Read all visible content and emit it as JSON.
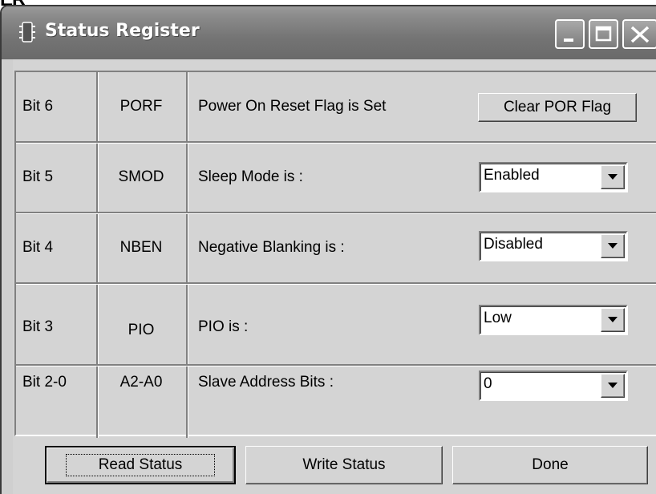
{
  "top_fragment": "ER",
  "window": {
    "title": "Status Register",
    "icon": "register-icon",
    "controls": [
      "minimize-icon",
      "maximize-icon",
      "close-icon"
    ]
  },
  "rows": [
    {
      "bit": "Bit 6",
      "name": "PORF",
      "desc": "Power On Reset Flag is Set",
      "control": "button",
      "button_label": "Clear POR Flag"
    },
    {
      "bit": "Bit 5",
      "name": "SMOD",
      "desc": "Sleep Mode is :",
      "control": "select",
      "value": "Enabled"
    },
    {
      "bit": "Bit 4",
      "name": "NBEN",
      "desc": "Negative Blanking is :",
      "control": "select",
      "value": "Disabled"
    },
    {
      "bit": "Bit 3",
      "name": "PIO",
      "desc": "PIO is :",
      "control": "select",
      "value": "Low"
    },
    {
      "bit": "Bit 2-0",
      "name": "A2-A0",
      "desc": "Slave Address Bits :",
      "control": "select",
      "value": "0"
    }
  ],
  "buttons": {
    "read": "Read Status",
    "write": "Write Status",
    "done": "Done"
  },
  "colors": {
    "titlebar": "#7a7a7a",
    "face": "#d4d4d4"
  }
}
